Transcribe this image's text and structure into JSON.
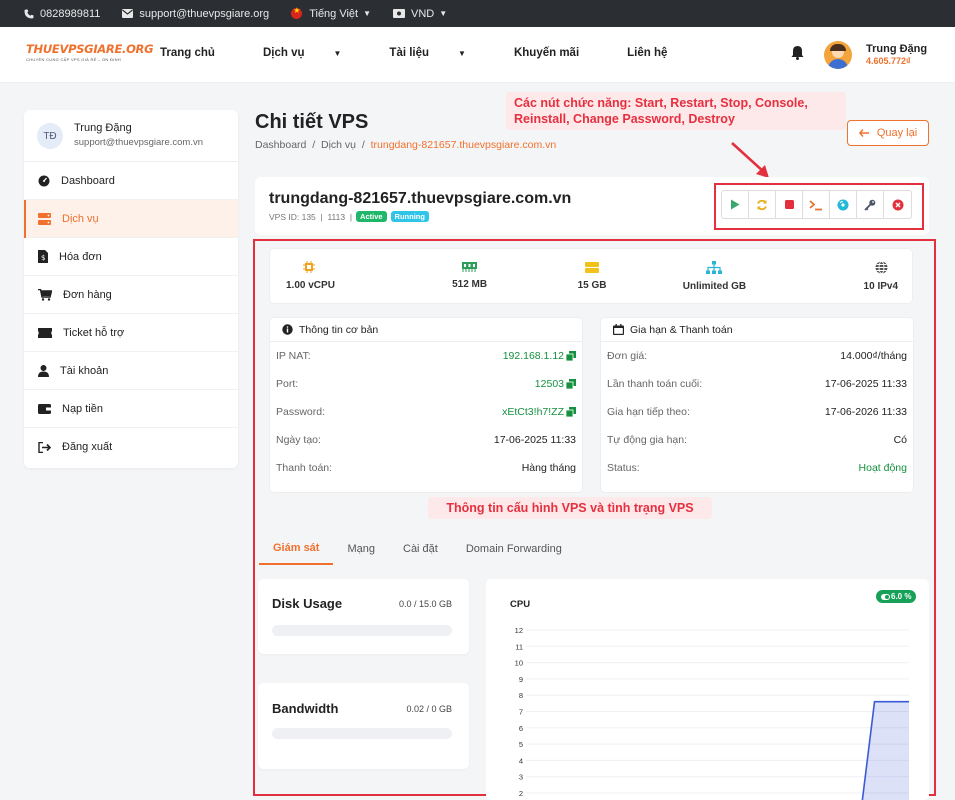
{
  "topbar": {
    "phone": "0828989811",
    "email": "support@thuevpsgiare.org",
    "language": "Tiếng Việt",
    "currency": "VND"
  },
  "header": {
    "logo_text": "THUEVPSGIARE.ORG",
    "logo_slogan": "CHUYÊN CUNG CẤP VPS GIÁ RẺ – ỔN ĐỊNH",
    "nav": [
      "Trang chủ",
      "Dịch vụ",
      "Tài liệu",
      "Khuyến mãi",
      "Liên hệ"
    ],
    "user_name": "Trung Đặng",
    "user_balance": "4.605.772₫"
  },
  "sidebar": {
    "avatar_initials": "TĐ",
    "name": "Trung Đặng",
    "email": "support@thuevpsgiare.com.vn",
    "items": [
      {
        "label": "Dashboard",
        "icon": "gauge-icon"
      },
      {
        "label": "Dịch vụ",
        "icon": "server-icon"
      },
      {
        "label": "Hóa đơn",
        "icon": "invoice-icon"
      },
      {
        "label": "Đơn hàng",
        "icon": "cart-icon"
      },
      {
        "label": "Ticket hỗ trợ",
        "icon": "ticket-icon"
      },
      {
        "label": "Tài khoản",
        "icon": "user-icon"
      },
      {
        "label": "Nạp tiền",
        "icon": "wallet-icon"
      },
      {
        "label": "Đăng xuất",
        "icon": "logout-icon"
      }
    ]
  },
  "page": {
    "title": "Chi tiết VPS",
    "breadcrumb": [
      "Dashboard",
      "Dịch vụ",
      "trungdang-821657.thuevpsgiare.com.vn"
    ],
    "back_label": "Quay lại"
  },
  "annotations": {
    "actions_note": "Các nút chức năng: Start, Restart, Stop, Console, Reinstall, Change Password, Destroy",
    "info_note": "Thông tin cấu hình VPS và tình trạng VPS"
  },
  "vps": {
    "hostname": "trungdang-821657.thuevpsgiare.com.vn",
    "id_text": "VPS ID: 135",
    "num": "1113",
    "status_badge": "Active",
    "power_badge": "Running"
  },
  "specs": [
    {
      "label": "1.00 vCPU",
      "icon": "cpu-icon"
    },
    {
      "label": "512 MB",
      "icon": "ram-icon"
    },
    {
      "label": "15 GB",
      "icon": "disk-icon"
    },
    {
      "label": "Unlimited GB",
      "icon": "network-icon"
    },
    {
      "label": "10 IPv4",
      "icon": "globe-icon"
    }
  ],
  "basic_info": {
    "title": "Thông tin cơ bản",
    "rows": [
      {
        "k": "IP NAT:",
        "v": "192.168.1.12"
      },
      {
        "k": "Port:",
        "v": "12503"
      },
      {
        "k": "Password:",
        "v": "xEtCt3!h7!ZZ"
      },
      {
        "k": "Ngày tạo:",
        "v": "17-06-2025 11:33"
      },
      {
        "k": "Thanh toán:",
        "v": "Hàng tháng"
      }
    ]
  },
  "billing": {
    "title": "Gia hạn & Thanh toán",
    "rows": [
      {
        "k": "Đơn giá:",
        "v": "14.000₫/tháng"
      },
      {
        "k": "Lần thanh toán cuối:",
        "v": "17-06-2025 11:33"
      },
      {
        "k": "Gia hạn tiếp theo:",
        "v": "17-06-2026 11:33"
      },
      {
        "k": "Tự động gia hạn:",
        "v": "Có"
      },
      {
        "k": "Status:",
        "v": "Hoạt động"
      }
    ]
  },
  "tabs": [
    "Giám sát",
    "Mạng",
    "Cài đặt",
    "Domain Forwarding"
  ],
  "disk": {
    "title": "Disk Usage",
    "value": "0.0 / 15.0 GB",
    "fraction": 0
  },
  "bandwidth": {
    "title": "Bandwidth",
    "value": "0.02 / 0 GB",
    "fraction": 0
  },
  "cpu": {
    "title": "CPU",
    "badge": "6.0 %"
  },
  "chart_data": {
    "type": "area",
    "title": "CPU",
    "yticks": [
      2,
      1,
      2,
      3,
      4,
      5,
      6,
      7,
      8,
      9,
      10,
      11,
      12
    ],
    "ylim": [
      0,
      12
    ],
    "x": [
      0,
      0.87,
      0.91,
      0.93,
      1
    ],
    "y": [
      0,
      0,
      7.6,
      7.6,
      7.6
    ],
    "color": "#3b5bd6"
  }
}
